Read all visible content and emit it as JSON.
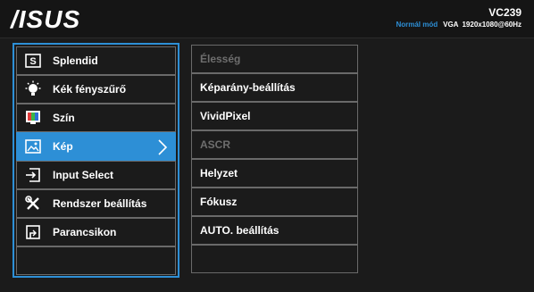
{
  "header": {
    "logo": "/ISUS",
    "model": "VC239",
    "status_mode": "Normál mód",
    "status_signal": "VGA",
    "status_resolution": "1920x1080@60Hz"
  },
  "menu": {
    "items": [
      {
        "label": "Splendid",
        "icon": "splendid-icon"
      },
      {
        "label": "Kék fényszűrő",
        "icon": "bulb-icon"
      },
      {
        "label": "Szín",
        "icon": "color-icon"
      },
      {
        "label": "Kép",
        "icon": "picture-icon",
        "active": true
      },
      {
        "label": "Input Select",
        "icon": "input-select-icon"
      },
      {
        "label": "Rendszer beállítás",
        "icon": "tools-icon"
      },
      {
        "label": "Parancsikon",
        "icon": "shortcut-icon"
      }
    ]
  },
  "submenu": {
    "items": [
      {
        "label": "Élesség",
        "enabled": false
      },
      {
        "label": "Képarány-beállítás",
        "enabled": true
      },
      {
        "label": "VividPixel",
        "enabled": true
      },
      {
        "label": "ASCR",
        "enabled": false
      },
      {
        "label": "Helyzet",
        "enabled": true
      },
      {
        "label": "Fókusz",
        "enabled": true
      },
      {
        "label": "AUTO. beállítás",
        "enabled": true
      }
    ]
  },
  "colors": {
    "accent": "#2d8fd6",
    "background": "#1b1b1b",
    "border": "#6a6a6a",
    "disabled_text": "#6e6e6e"
  }
}
